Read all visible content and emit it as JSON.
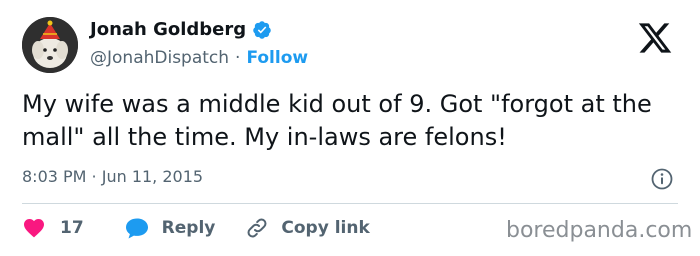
{
  "author": {
    "name": "Jonah Goldberg",
    "handle": "@JonahDispatch",
    "separator": "·",
    "follow_label": "Follow",
    "verified_color": "#1d9bf0"
  },
  "tweet": {
    "text": "My wife was a middle kid out of 9. Got \"forgot at the mall\" all the time. My in-laws are felons!",
    "time": "8:03 PM · Jun 11, 2015"
  },
  "actions": {
    "like_count": "17",
    "reply_label": "Reply",
    "copy_label": "Copy link"
  },
  "watermark": "boredpanda.com",
  "colors": {
    "accent": "#1d9bf0",
    "like": "#f91880",
    "text": "#0f1419",
    "muted": "#536471"
  },
  "icons": {
    "brand": "x-logo-icon",
    "verified": "verified-badge-icon",
    "info": "info-icon",
    "like": "heart-icon",
    "reply": "speech-bubble-icon",
    "copy": "link-icon"
  }
}
